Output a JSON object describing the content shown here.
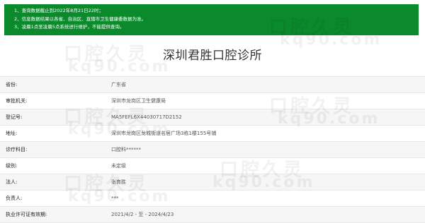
{
  "notice": {
    "lines": [
      "1、查询数据截止到2022年8月21日22时；",
      "2、信息数据结果以各省、自治区、直辖市卫生健康委数据为准。",
      "3、凌晨1点至凌晨5点系统进行维护，不能提供查询。"
    ]
  },
  "clinic_name": "深圳君胜口腔诊所",
  "fields": [
    {
      "label": "省份:",
      "value": "广东省"
    },
    {
      "label": "审批机关:",
      "value": "深圳市龙岗区卫生健康局"
    },
    {
      "label": "登记号:",
      "value": "MA5FEFL6X44030717D2152"
    },
    {
      "label": "地址:",
      "value": "深圳市龙岗区龙城街道名居广场3栋1楼155号铺"
    },
    {
      "label": "诊疗科目:",
      "value": "口腔科******"
    },
    {
      "label": "级别:",
      "value": "未定级"
    },
    {
      "label": "法人:",
      "value": "张育胜"
    },
    {
      "label": "负责人:",
      "value": "***"
    },
    {
      "label": "执业许可证有效期:",
      "value": "2021/4/2 - 至 - 2024/4/23"
    }
  ],
  "watermark": {
    "cn": "口腔久灵",
    "en": "kq90.com"
  }
}
